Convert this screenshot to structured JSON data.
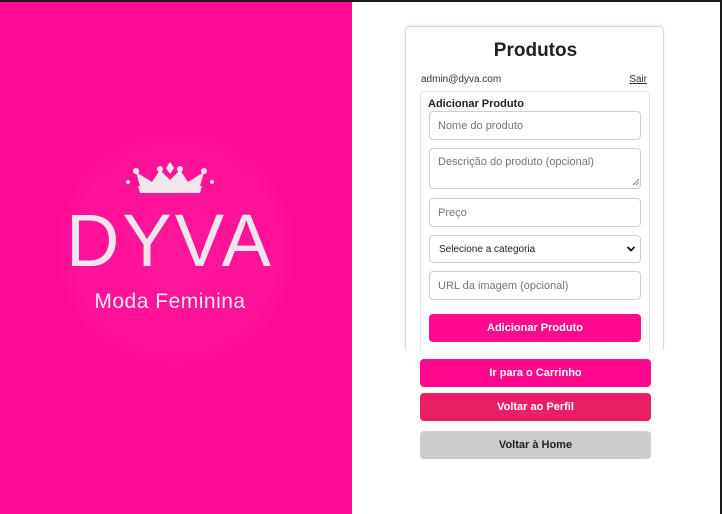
{
  "brand": {
    "name": "DYVA",
    "tagline": "Moda Feminina"
  },
  "products": {
    "title": "Produtos",
    "user_email": "admin@dyva.com",
    "logout_label": "Sair",
    "form": {
      "heading": "Adicionar Produto",
      "name_placeholder": "Nome do produto",
      "description_placeholder": "Descrição do produto (opcional)",
      "price_placeholder": "Preço",
      "category_selected": "Selecione a categoria",
      "image_url_placeholder": "URL da imagem (opcional)",
      "submit_label": "Adicionar Produto"
    }
  },
  "navigation": {
    "cart_label": "Ir para o Carrinho",
    "profile_label": "Voltar ao Perfil",
    "home_label": "Voltar à Home"
  },
  "colors": {
    "brand_pink": "#ff0a95",
    "button_pink": "#ff0a8f",
    "profile_button": "#ea1f66",
    "home_button": "#cccccc"
  },
  "icons": {
    "crown": "crown-icon",
    "select_arrow": "chevron-down-icon",
    "resize_handle": "resize-grip-icon"
  }
}
